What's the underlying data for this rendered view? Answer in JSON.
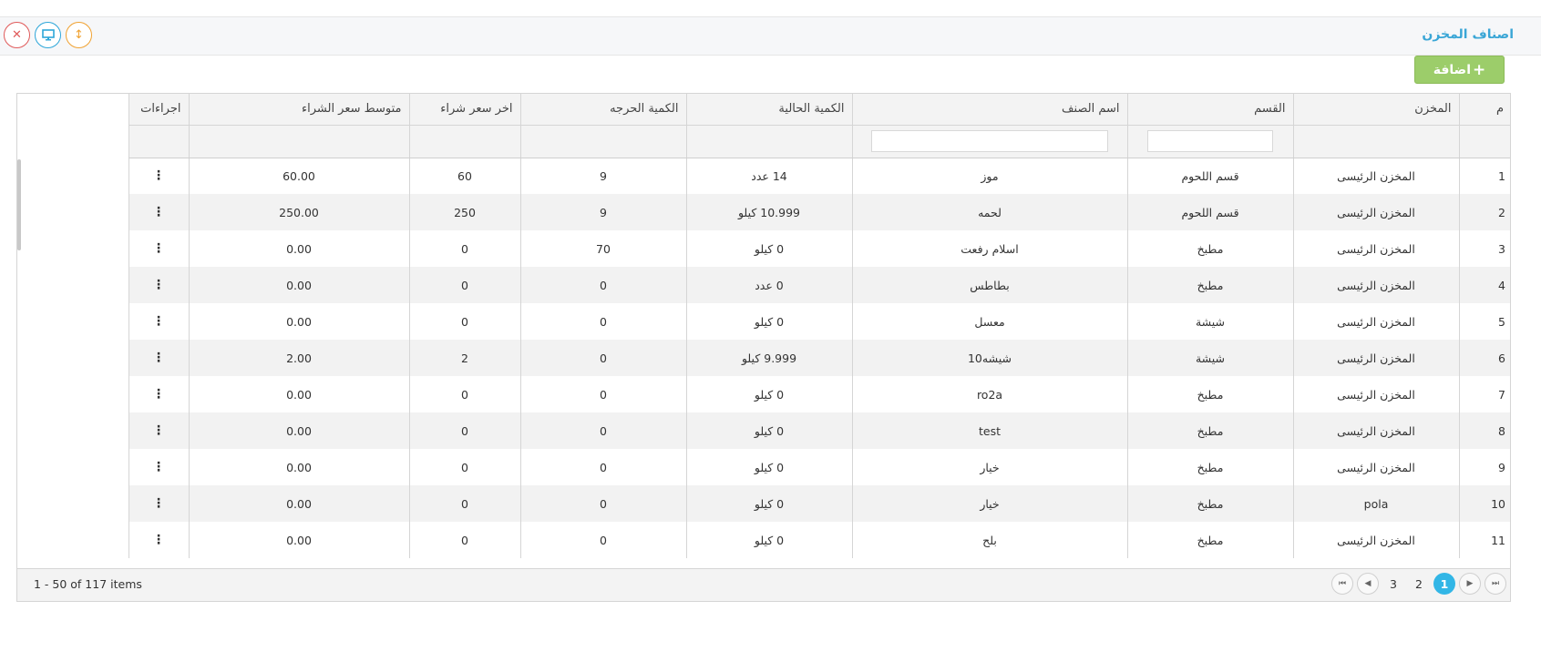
{
  "panel": {
    "title": "اصناف المخزن"
  },
  "header_buttons": {
    "close": "✕",
    "screen": "🖥",
    "resize": "↕"
  },
  "toolbar": {
    "add_label": "اضافة",
    "add_icon": "+"
  },
  "table": {
    "columns": [
      "م",
      "المخزن",
      "القسم",
      "اسم الصنف",
      "الكمية الحالية",
      "الكمية الحرجه",
      "اخر سعر شراء",
      "متوسط سعر الشراء",
      "اجراءات"
    ],
    "rows": [
      [
        "1",
        "المخزن الرئيسى",
        "قسم اللحوم",
        "موز",
        "14 عدد",
        "9",
        "60",
        "60.00"
      ],
      [
        "2",
        "المخزن الرئيسى",
        "قسم اللحوم",
        "لحمه",
        "10.999 كيلو",
        "9",
        "250",
        "250.00"
      ],
      [
        "3",
        "المخزن الرئيسى",
        "مطبخ",
        "اسلام رفعت",
        "0 كيلو",
        "70",
        "0",
        "0.00"
      ],
      [
        "4",
        "المخزن الرئيسى",
        "مطبخ",
        "بطاطس",
        "0 عدد",
        "0",
        "0",
        "0.00"
      ],
      [
        "5",
        "المخزن الرئيسى",
        "شيشة",
        "معسل",
        "0 كيلو",
        "0",
        "0",
        "0.00"
      ],
      [
        "6",
        "المخزن الرئيسى",
        "شيشة",
        "شيشه10",
        "9.999 كيلو",
        "0",
        "2",
        "2.00"
      ],
      [
        "7",
        "المخزن الرئيسى",
        "مطبخ",
        "ro2a",
        "0 كيلو",
        "0",
        "0",
        "0.00"
      ],
      [
        "8",
        "المخزن الرئيسى",
        "مطبخ",
        "test",
        "0 كيلو",
        "0",
        "0",
        "0.00"
      ],
      [
        "9",
        "المخزن الرئيسى",
        "مطبخ",
        "خيار",
        "0 كيلو",
        "0",
        "0",
        "0.00"
      ],
      [
        "10",
        "pola",
        "مطبخ",
        "خيار",
        "0 كيلو",
        "0",
        "0",
        "0.00"
      ],
      [
        "11",
        "المخزن الرئيسى",
        "مطبخ",
        "بلح",
        "0 كيلو",
        "0",
        "0",
        "0.00"
      ]
    ],
    "actions_icon": "⋮"
  },
  "footer": {
    "items_info": "1 - 50 of 117 items",
    "pages": [
      "1",
      "2",
      "3"
    ],
    "active_page": "1",
    "first_icon": "⏮",
    "prev_icon": "◀",
    "next_icon": "▶",
    "last_icon": "⏭"
  }
}
